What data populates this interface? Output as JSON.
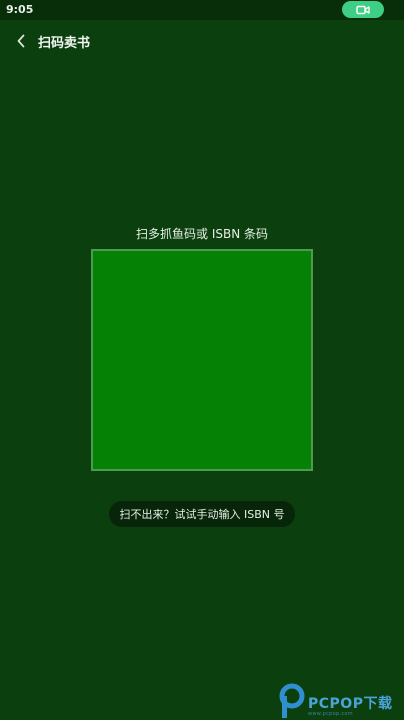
{
  "status_bar": {
    "time": "9:05",
    "record_icon": "video-camera-icon",
    "colors": {
      "pill": "#3fce86"
    }
  },
  "app_bar": {
    "back_icon": "chevron-left-icon",
    "title": "扫码卖书"
  },
  "scanner": {
    "hint": "扫多抓鱼码或 ISBN 条码",
    "manual_entry_label": "扫不出来？试试手动输入 ISBN 号",
    "colors": {
      "background": "#0b3f0e",
      "frame": "#058205",
      "frame_border": "#4e9a4e"
    }
  },
  "watermark": {
    "logo": "pcpop-logo-icon",
    "text": "PCPOP下载",
    "subtext": "www.pcpop.com"
  }
}
